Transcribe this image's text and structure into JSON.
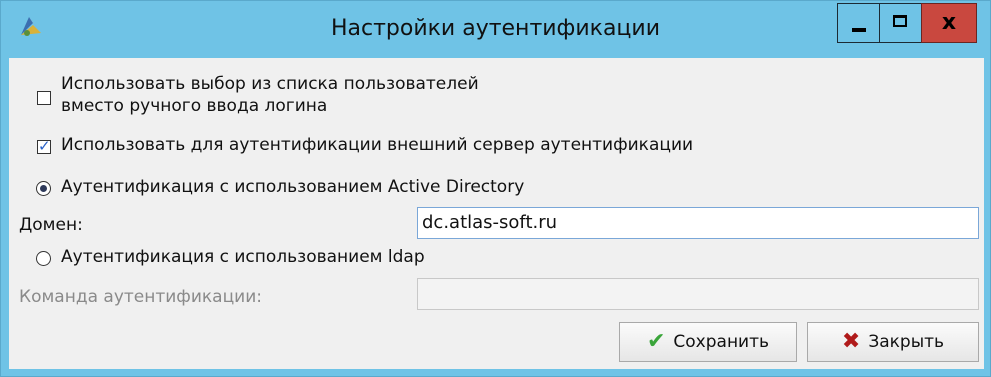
{
  "window": {
    "title": "Настройки аутентификации",
    "controls": {
      "minimize": "minimize-icon",
      "maximize": "maximize-icon",
      "close_glyph": "x"
    }
  },
  "options": {
    "use_user_list": {
      "label_line1": "Использовать выбор из списка пользователей",
      "label_line2": "вместо ручного ввода логина",
      "checked": false
    },
    "use_external_server": {
      "label": "Использовать для аутентификации внешний сервер аутентификации",
      "checked": true
    }
  },
  "auth_method": {
    "active_directory": {
      "label": "Аутентификация с использованием Active Directory",
      "selected": true
    },
    "domain": {
      "label": "Домен:",
      "value": "dc.atlas-soft.ru"
    },
    "ldap": {
      "label": "Аутентификация с использованием ldap",
      "selected": false
    },
    "auth_command": {
      "label": "Команда аутентификации:",
      "value": ""
    }
  },
  "buttons": {
    "save": {
      "label": "Сохранить",
      "icon": "checkmark-icon"
    },
    "close": {
      "label": "Закрыть",
      "icon": "close-x-icon"
    }
  },
  "colors": {
    "titlebar": "#6fc3e6",
    "close_button": "#c9483f",
    "panel": "#f0f0f0"
  }
}
